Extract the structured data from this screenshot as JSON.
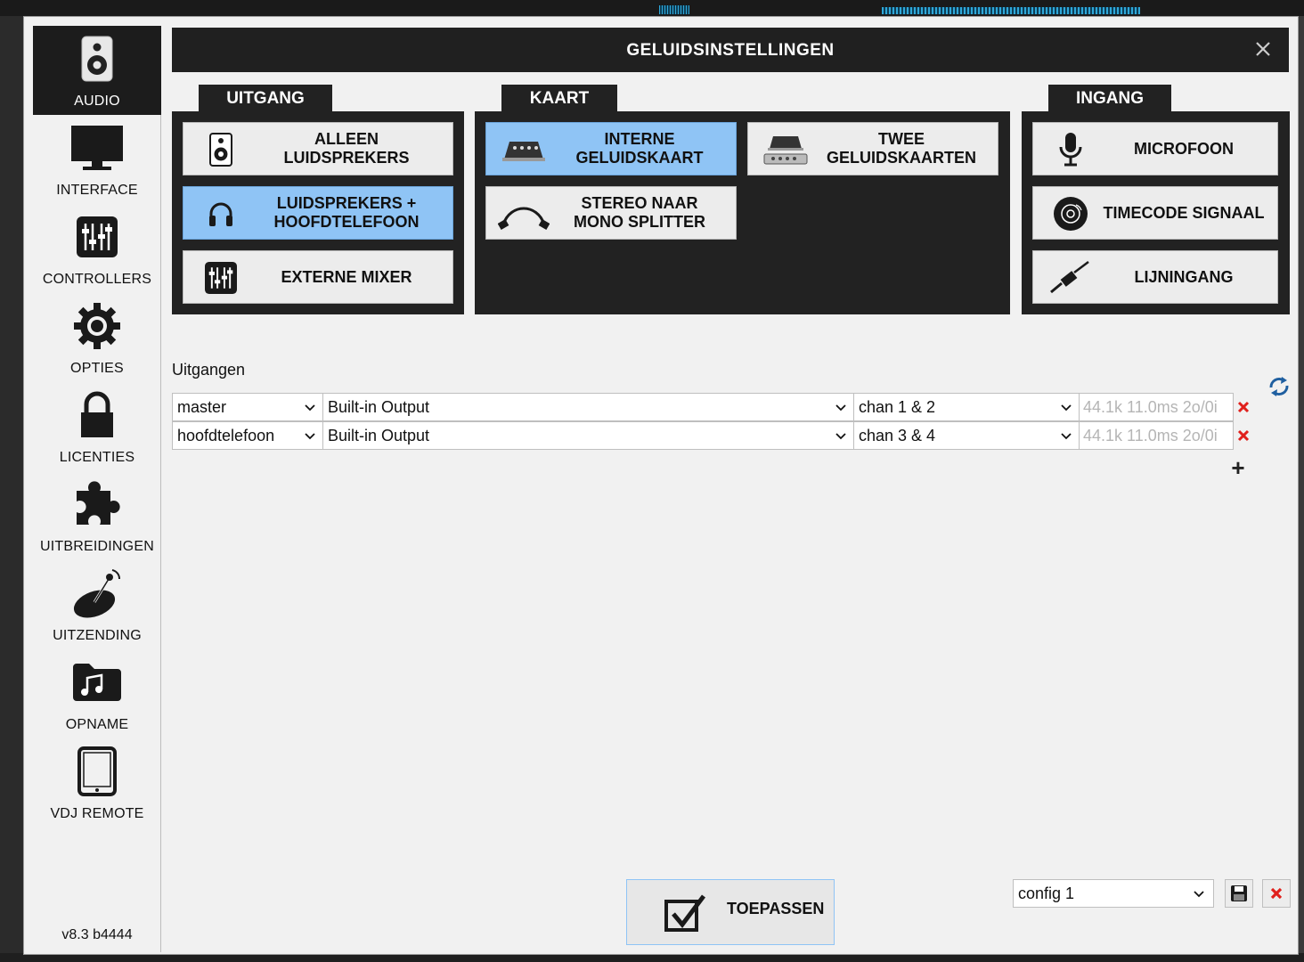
{
  "dialog": {
    "title": "GELUIDSINSTELLINGEN"
  },
  "sidebar": {
    "items": [
      {
        "label": "AUDIO",
        "icon": "speaker-icon",
        "active": true
      },
      {
        "label": "INTERFACE",
        "icon": "monitor-icon"
      },
      {
        "label": "CONTROLLERS",
        "icon": "mixer-sliders-icon"
      },
      {
        "label": "OPTIES",
        "icon": "gear-icon"
      },
      {
        "label": "LICENTIES",
        "icon": "lock-icon"
      },
      {
        "label": "UITBREIDINGEN",
        "icon": "puzzle-icon"
      },
      {
        "label": "UITZENDING",
        "icon": "satellite-dish-icon"
      },
      {
        "label": "OPNAME",
        "icon": "music-folder-icon"
      },
      {
        "label": "VDJ REMOTE",
        "icon": "tablet-icon"
      }
    ],
    "version": "v8.3 b4444"
  },
  "uitgang": {
    "tab": "UITGANG",
    "buttons": [
      {
        "label": "ALLEEN\nLUIDSPREKERS",
        "icon": "speaker-icon",
        "selected": false
      },
      {
        "label": "LUIDSPREKERS +\nHOOFDTELEFOON",
        "icon": "headphones-icon",
        "selected": true
      },
      {
        "label": "EXTERNE MIXER",
        "icon": "mixer-sliders-icon",
        "selected": false
      }
    ]
  },
  "kaart": {
    "tab": "KAART",
    "buttons": [
      {
        "label": "INTERNE\nGELUIDSKAART",
        "icon": "sound-card-icon",
        "selected": true
      },
      {
        "label": "TWEE\nGELUIDSKAARTEN",
        "icon": "two-sound-cards-icon",
        "selected": false
      },
      {
        "label": "STEREO NAAR\nMONO SPLITTER",
        "icon": "splitter-cable-icon",
        "selected": false
      }
    ]
  },
  "ingang": {
    "tab": "INGANG",
    "buttons": [
      {
        "label": "MICROFOON",
        "icon": "microphone-icon",
        "selected": false
      },
      {
        "label": "TIMECODE SIGNAAL",
        "icon": "vinyl-icon",
        "selected": false
      },
      {
        "label": "LIJNINGANG",
        "icon": "jack-plug-icon",
        "selected": false
      }
    ]
  },
  "outputs": {
    "label": "Uitgangen",
    "rows": [
      {
        "role": "master",
        "device": "Built-in Output",
        "channels": "chan 1 & 2",
        "info": "44.1k 11.0ms 2o/0i"
      },
      {
        "role": "hoofdtelefoon",
        "device": "Built-in Output",
        "channels": "chan 3 & 4",
        "info": "44.1k 11.0ms 2o/0i"
      }
    ],
    "add_label": "+"
  },
  "footer": {
    "apply_label": "TOEPASSEN",
    "config_value": "config 1"
  },
  "colors": {
    "selected": "#8fc4f5",
    "dark": "#222222",
    "delete": "#e0201c"
  }
}
